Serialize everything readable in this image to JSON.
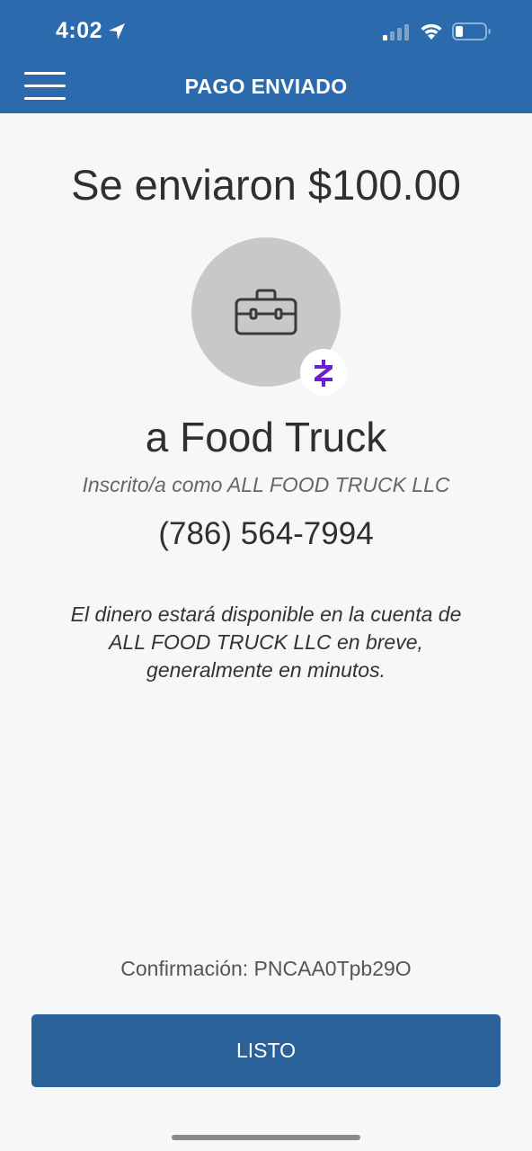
{
  "status_bar": {
    "time": "4:02"
  },
  "header": {
    "title": "PAGO ENVIADO"
  },
  "main": {
    "amount_title": "Se enviaron $100.00",
    "recipient_name": "a Food Truck",
    "enrolled_as": "Inscrito/a como ALL FOOD TRUCK LLC",
    "phone": "(786) 564-7994",
    "info": "El dinero estará disponible en la cuenta de ALL FOOD TRUCK LLC en breve, generalmente en minutos.",
    "confirmation": "Confirmación: PNCAA0Tpb29O",
    "done_label": "LISTO"
  },
  "colors": {
    "header": "#2b6aad",
    "button": "#2b6299",
    "zelle": "#6d1ed4",
    "avatar": "#c8c8c8"
  },
  "icons": [
    "location-arrow-icon",
    "cellular-signal-icon",
    "wifi-icon",
    "battery-icon",
    "hamburger-menu-icon",
    "briefcase-icon",
    "zelle-icon"
  ]
}
